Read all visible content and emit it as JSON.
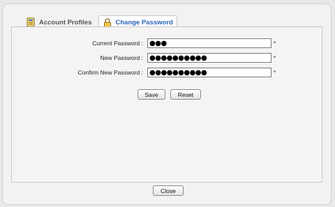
{
  "tabs": [
    {
      "label": "Account Profiles",
      "icon": "profile-card-icon"
    },
    {
      "label": "Change Password",
      "icon": "lock-icon"
    }
  ],
  "form": {
    "current_password": {
      "label": "Current Password :",
      "value": "●●●",
      "required": "*"
    },
    "new_password": {
      "label": "New Password :",
      "value": "●●●●●●●●●●",
      "required": "*"
    },
    "confirm_password": {
      "label": "Confirm New Password :",
      "value": "●●●●●●●●●●",
      "required": "*"
    }
  },
  "buttons": {
    "save": "Save",
    "reset": "Reset",
    "close": "Close"
  },
  "colors": {
    "active_tab_text": "#2a66b8",
    "background": "#f2f2f2"
  }
}
